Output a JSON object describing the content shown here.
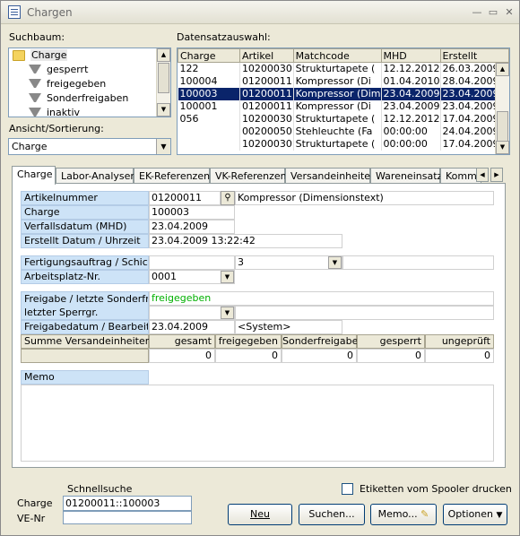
{
  "window": {
    "title": "Chargen"
  },
  "left": {
    "suchbaum_label": "Suchbaum:",
    "tree": [
      {
        "label": "Charge",
        "icon": "folder-icon",
        "selected": true
      },
      {
        "label": "gesperrt",
        "icon": "filter-icon"
      },
      {
        "label": "freigegeben",
        "icon": "filter-icon"
      },
      {
        "label": "Sonderfreigaben",
        "icon": "filter-icon"
      },
      {
        "label": "inaktiv",
        "icon": "filter-icon"
      }
    ],
    "ansicht_label": "Ansicht/Sortierung:",
    "ansicht_value": "Charge"
  },
  "grid": {
    "label": "Datensatzauswahl:",
    "columns": [
      "Charge",
      "Artikel",
      "Matchcode",
      "MHD",
      "Erstellt"
    ],
    "rows": [
      [
        "122",
        "10200030",
        "Strukturtapete (",
        "12.12.2012",
        "26.03.2009 1"
      ],
      [
        "100004",
        "01200011",
        "Kompressor (Di",
        "01.04.2010",
        "28.04.2009 0"
      ],
      [
        "100003",
        "01200011",
        "Kompressor (Dim",
        "23.04.2009",
        "23.04.2009 1"
      ],
      [
        "100001",
        "01200011",
        "Kompressor (Di",
        "23.04.2009",
        "23.04.2009 1"
      ],
      [
        "056",
        "10200030",
        "Strukturtapete (",
        "12.12.2012",
        "17.04.2009 1"
      ],
      [
        "",
        "00200050",
        "Stehleuchte (Fa",
        "00:00:00",
        "24.04.2009 1"
      ],
      [
        "",
        "10200030",
        "Strukturtapete (",
        "00:00:00",
        "17.04.2009 1"
      ]
    ],
    "selected_row": 2
  },
  "tabs": [
    "Charge",
    "Labor-Analysen",
    "EK-Referenzen",
    "VK-Referenzen",
    "Versandeinheiten",
    "Wareneinsatz",
    "Kommis"
  ],
  "form": {
    "artikelnummer_label": "Artikelnummer",
    "artikelnummer_value": "01200011",
    "artikel_text": "Kompressor (Dimensionstext)",
    "charge_label": "Charge",
    "charge_value": "100003",
    "verfall_label": "Verfallsdatum (MHD)",
    "verfall_value": "23.04.2009",
    "erstellt_label": "Erstellt Datum / Uhrzeit",
    "erstellt_value": "23.04.2009 13:22:42",
    "fertigung_label": "Fertigungsauftrag / Schicht",
    "fertigung_value": "",
    "schicht_value": "3",
    "arbeitsplatz_label": "Arbeitsplatz-Nr.",
    "arbeitsplatz_value": "0001",
    "freigabe_label": "Freigabe / letzte Sonderfr.",
    "freigabe_value": "freigegeben",
    "freigabe_color": "#00b000",
    "sperrgr_label": "letzter Sperrgr.",
    "freigabedatum_label": "Freigabedatum / Bearbeiter",
    "freigabedatum_value": "23.04.2009",
    "bearbeiter_value": "<System>",
    "summe_label": "Summe Versandeinheiten",
    "summe_headers": [
      "gesamt",
      "freigegeben",
      "Sonderfreigabe",
      "gesperrt",
      "ungeprüft"
    ],
    "summe_values": [
      "0",
      "0",
      "0",
      "0",
      "0"
    ],
    "memo_label": "Memo"
  },
  "bottom": {
    "schnellsuche_label": "Schnellsuche",
    "charge_label": "Charge",
    "charge_value": "01200011::100003",
    "vnr_label": "VE-Nr",
    "vnr_value": "",
    "etiketten_label": "Etiketten vom Spooler drucken",
    "neu_label": "Neu",
    "suchen_label": "Suchen...",
    "memo_label": "Memo...",
    "optionen_label": "Optionen"
  }
}
